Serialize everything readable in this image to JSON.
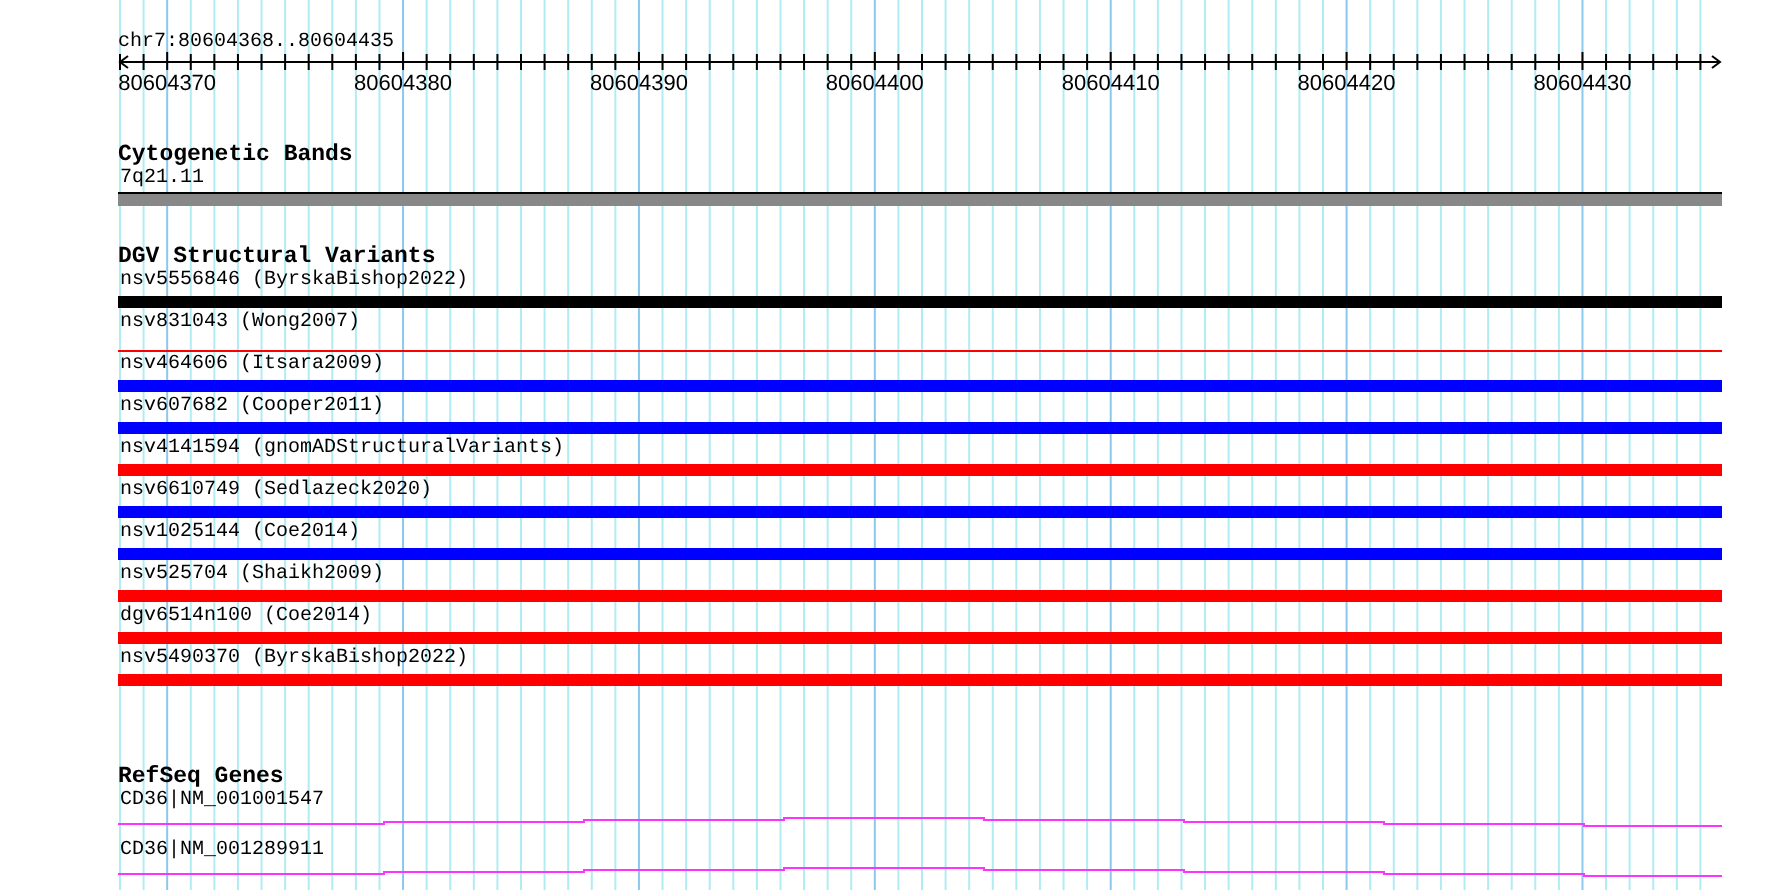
{
  "ruler": {
    "location": "chr7:80604368..80604435",
    "ticks": [
      "80604370",
      "80604380",
      "80604390",
      "80604400",
      "80604410",
      "80604420",
      "80604430"
    ]
  },
  "cytogenetic_bands": {
    "title": "Cytogenetic Bands",
    "bands": [
      {
        "label": "7q21.11"
      }
    ]
  },
  "dgv_structural_variants": {
    "title": "DGV Structural Variants",
    "features": [
      {
        "label": "nsv5556846 (ByrskaBishop2022)",
        "color": "#000000",
        "kind": "thick"
      },
      {
        "label": "nsv831043 (Wong2007)",
        "color": "#ff0000",
        "kind": "thin"
      },
      {
        "label": "nsv464606 (Itsara2009)",
        "color": "#0000ff",
        "kind": "thick"
      },
      {
        "label": "nsv607682 (Cooper2011)",
        "color": "#0000ff",
        "kind": "thick"
      },
      {
        "label": "nsv4141594 (gnomADStructuralVariants)",
        "color": "#ff0000",
        "kind": "thick"
      },
      {
        "label": "nsv6610749 (Sedlazeck2020)",
        "color": "#0000ff",
        "kind": "thick"
      },
      {
        "label": "nsv1025144 (Coe2014)",
        "color": "#0000ff",
        "kind": "thick"
      },
      {
        "label": "nsv525704 (Shaikh2009)",
        "color": "#ff0000",
        "kind": "thick"
      },
      {
        "label": "dgv6514n100 (Coe2014)",
        "color": "#ff0000",
        "kind": "thick"
      },
      {
        "label": "nsv5490370 (ByrskaBishop2022)",
        "color": "#ff0000",
        "kind": "thick"
      }
    ]
  },
  "refseq_genes": {
    "title": "RefSeq Genes",
    "features": [
      {
        "label": "CD36|NM_001001547"
      },
      {
        "label": "CD36|NM_001289911"
      }
    ]
  }
}
